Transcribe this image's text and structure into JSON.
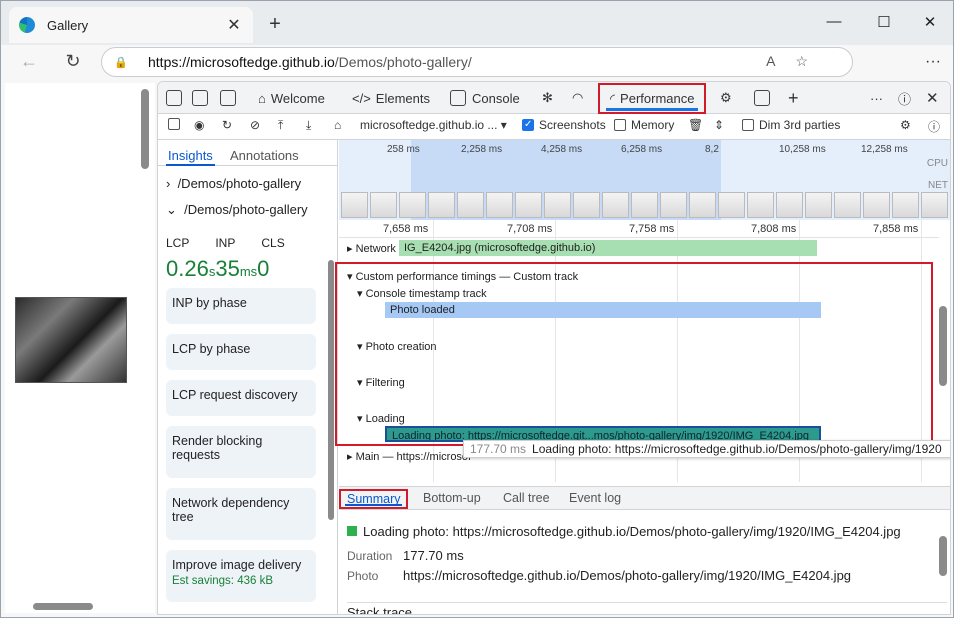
{
  "browser": {
    "tab_title": "Gallery",
    "url_host": "https://microsoftedge.github.io",
    "url_path": "/Demos/photo-gallery/"
  },
  "devtools": {
    "tabs": {
      "welcome": "Welcome",
      "elements": "Elements",
      "console": "Console",
      "performance": "Performance"
    },
    "toolbar": {
      "origin": "microsoftedge.github.io ...",
      "screenshots": "Screenshots",
      "memory": "Memory",
      "dim": "Dim 3rd parties"
    },
    "sidebar": {
      "insights_tab": "Insights",
      "annotations_tab": "Annotations",
      "path1": "/Demos/photo-gallery",
      "path2": "/Demos/photo-gallery",
      "metrics": {
        "lcp_label": "LCP",
        "inp_label": "INP",
        "cls_label": "CLS",
        "lcp_value": "0.26",
        "lcp_unit": "s",
        "inp_value": "35",
        "inp_unit": "ms",
        "cls_value": "0"
      },
      "cards": [
        "INP by phase",
        "LCP by phase",
        "LCP request discovery",
        "Render blocking requests",
        "Network dependency tree",
        "Improve image delivery"
      ],
      "savings": "Est savings: 436 kB"
    },
    "overview": {
      "ticks": [
        "258 ms",
        "2,258 ms",
        "4,258 ms",
        "6,258 ms",
        "8,2",
        "10,258 ms",
        "12,258 ms"
      ],
      "cpu": "CPU",
      "net": "NET"
    },
    "ruler": [
      "7,658 ms",
      "7,708 ms",
      "7,758 ms",
      "7,808 ms",
      "7,858 ms"
    ],
    "tracks": {
      "network": "Network",
      "network_bar": "IG_E4204.jpg (microsoftedge.github.io)",
      "custom": "Custom performance timings — Custom track",
      "console_ts": "Console timestamp track",
      "photo_loaded": "Photo loaded",
      "photo_creation": "Photo creation",
      "filtering": "Filtering",
      "loading": "Loading",
      "loading_bar": "Loading photo: https://microsoftedge.git...mos/photo-gallery/img/1920/IMG_E4204.jpg",
      "main": "Main — https://microsof"
    },
    "tooltip": {
      "duration": "177.70 ms",
      "text": "Loading photo: https://microsoftedge.github.io/Demos/photo-gallery/img/1920"
    },
    "bottom_tabs": {
      "summary": "Summary",
      "bottom_up": "Bottom-up",
      "call_tree": "Call tree",
      "event_log": "Event log"
    },
    "summary": {
      "title": "Loading photo: https://microsoftedge.github.io/Demos/photo-gallery/img/1920/IMG_E4204.jpg",
      "duration_label": "Duration",
      "duration": "177.70 ms",
      "photo_label": "Photo",
      "photo": "https://microsoftedge.github.io/Demos/photo-gallery/img/1920/IMG_E4204.jpg",
      "stack_trace": "Stack trace"
    }
  },
  "colors": {
    "accent": "#1a73e8",
    "highlight": "#d11b2a",
    "good": "#188038"
  }
}
